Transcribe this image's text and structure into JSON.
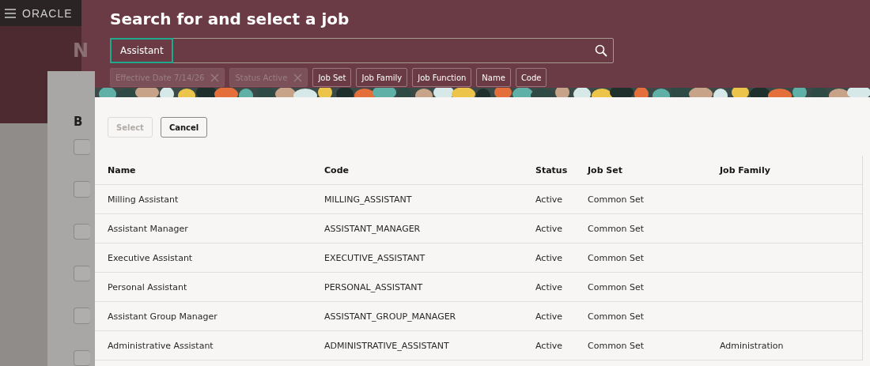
{
  "background": {
    "logo": "ORACLE",
    "heading": "N",
    "section": "B"
  },
  "dialog": {
    "title": "Search for and select a job",
    "search": {
      "value": "Assistant"
    },
    "filters": [
      {
        "label": "Effective Date 7/14/26",
        "disabled": true,
        "removable": true
      },
      {
        "label": "Status Active",
        "disabled": true,
        "removable": true
      },
      {
        "label": "Job Set",
        "disabled": false,
        "removable": false
      },
      {
        "label": "Job Family",
        "disabled": false,
        "removable": false
      },
      {
        "label": "Job Function",
        "disabled": false,
        "removable": false
      },
      {
        "label": "Name",
        "disabled": false,
        "removable": false
      },
      {
        "label": "Code",
        "disabled": false,
        "removable": false
      }
    ],
    "buttons": [
      {
        "label": "Select",
        "disabled": true
      },
      {
        "label": "Cancel",
        "disabled": false
      }
    ],
    "table": {
      "columns": [
        "Name",
        "Code",
        "Status",
        "Job Set",
        "Job Family"
      ],
      "rows": [
        [
          "Milling Assistant",
          "MILLING_ASSISTANT",
          "Active",
          "Common Set",
          ""
        ],
        [
          "Assistant Manager",
          "ASSISTANT_MANAGER",
          "Active",
          "Common Set",
          ""
        ],
        [
          "Executive Assistant",
          "EXECUTIVE_ASSISTANT",
          "Active",
          "Common Set",
          ""
        ],
        [
          "Personal Assistant",
          "PERSONAL_ASSISTANT",
          "Active",
          "Common Set",
          ""
        ],
        [
          "Assistant Group Manager",
          "ASSISTANT_GROUP_MANAGER",
          "Active",
          "Common Set",
          ""
        ],
        [
          "Administrative Assistant",
          "ADMINISTRATIVE_ASSISTANT",
          "Active",
          "Common Set",
          "Administration"
        ]
      ]
    }
  }
}
